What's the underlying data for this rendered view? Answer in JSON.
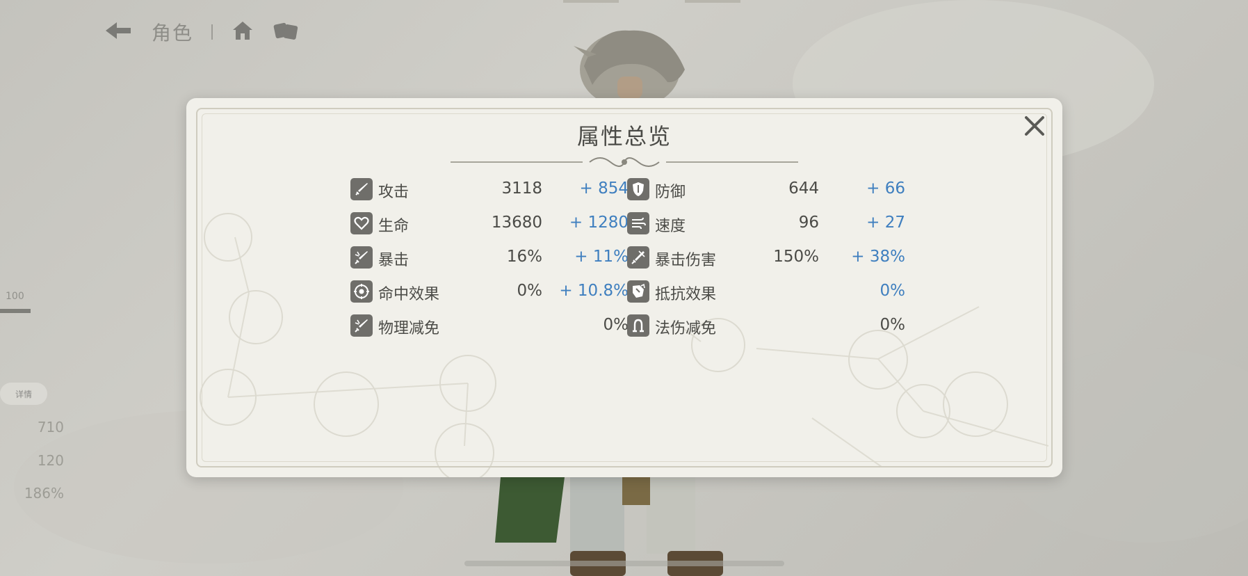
{
  "background": {
    "nav_title": "角色",
    "side_value": "100",
    "side_tag": "详情",
    "side_stats": [
      "710",
      "120",
      "186%"
    ]
  },
  "modal": {
    "title": "属性总览",
    "close_icon": "close-x-icon",
    "accent_color": "#3f7fbf",
    "stats_left": [
      {
        "label": "攻击",
        "base": "3118",
        "bonus": "+ 854",
        "icon": "sword-icon"
      },
      {
        "label": "生命",
        "base": "13680",
        "bonus": "+ 1280",
        "icon": "heart-icon"
      },
      {
        "label": "暴击",
        "base": "16%",
        "bonus": "+ 11%",
        "icon": "crit-sword-icon"
      },
      {
        "label": "命中效果",
        "base": "0%",
        "bonus": "+ 10.8%",
        "icon": "target-icon"
      },
      {
        "label": "物理减免",
        "base": "",
        "bonus": "0%",
        "icon": "physical-shield-icon"
      }
    ],
    "stats_right": [
      {
        "label": "防御",
        "base": "644",
        "bonus": "+ 66",
        "icon": "shield-icon"
      },
      {
        "label": "速度",
        "base": "96",
        "bonus": "+ 27",
        "icon": "wind-icon"
      },
      {
        "label": "暴击伤害",
        "base": "150%",
        "bonus": "+ 38%",
        "icon": "crit-damage-icon"
      },
      {
        "label": "抵抗效果",
        "base": "",
        "bonus": "0%",
        "icon": "resist-icon"
      },
      {
        "label": "法伤减免",
        "base": "",
        "bonus": "0%",
        "icon": "magic-shield-icon"
      }
    ]
  }
}
